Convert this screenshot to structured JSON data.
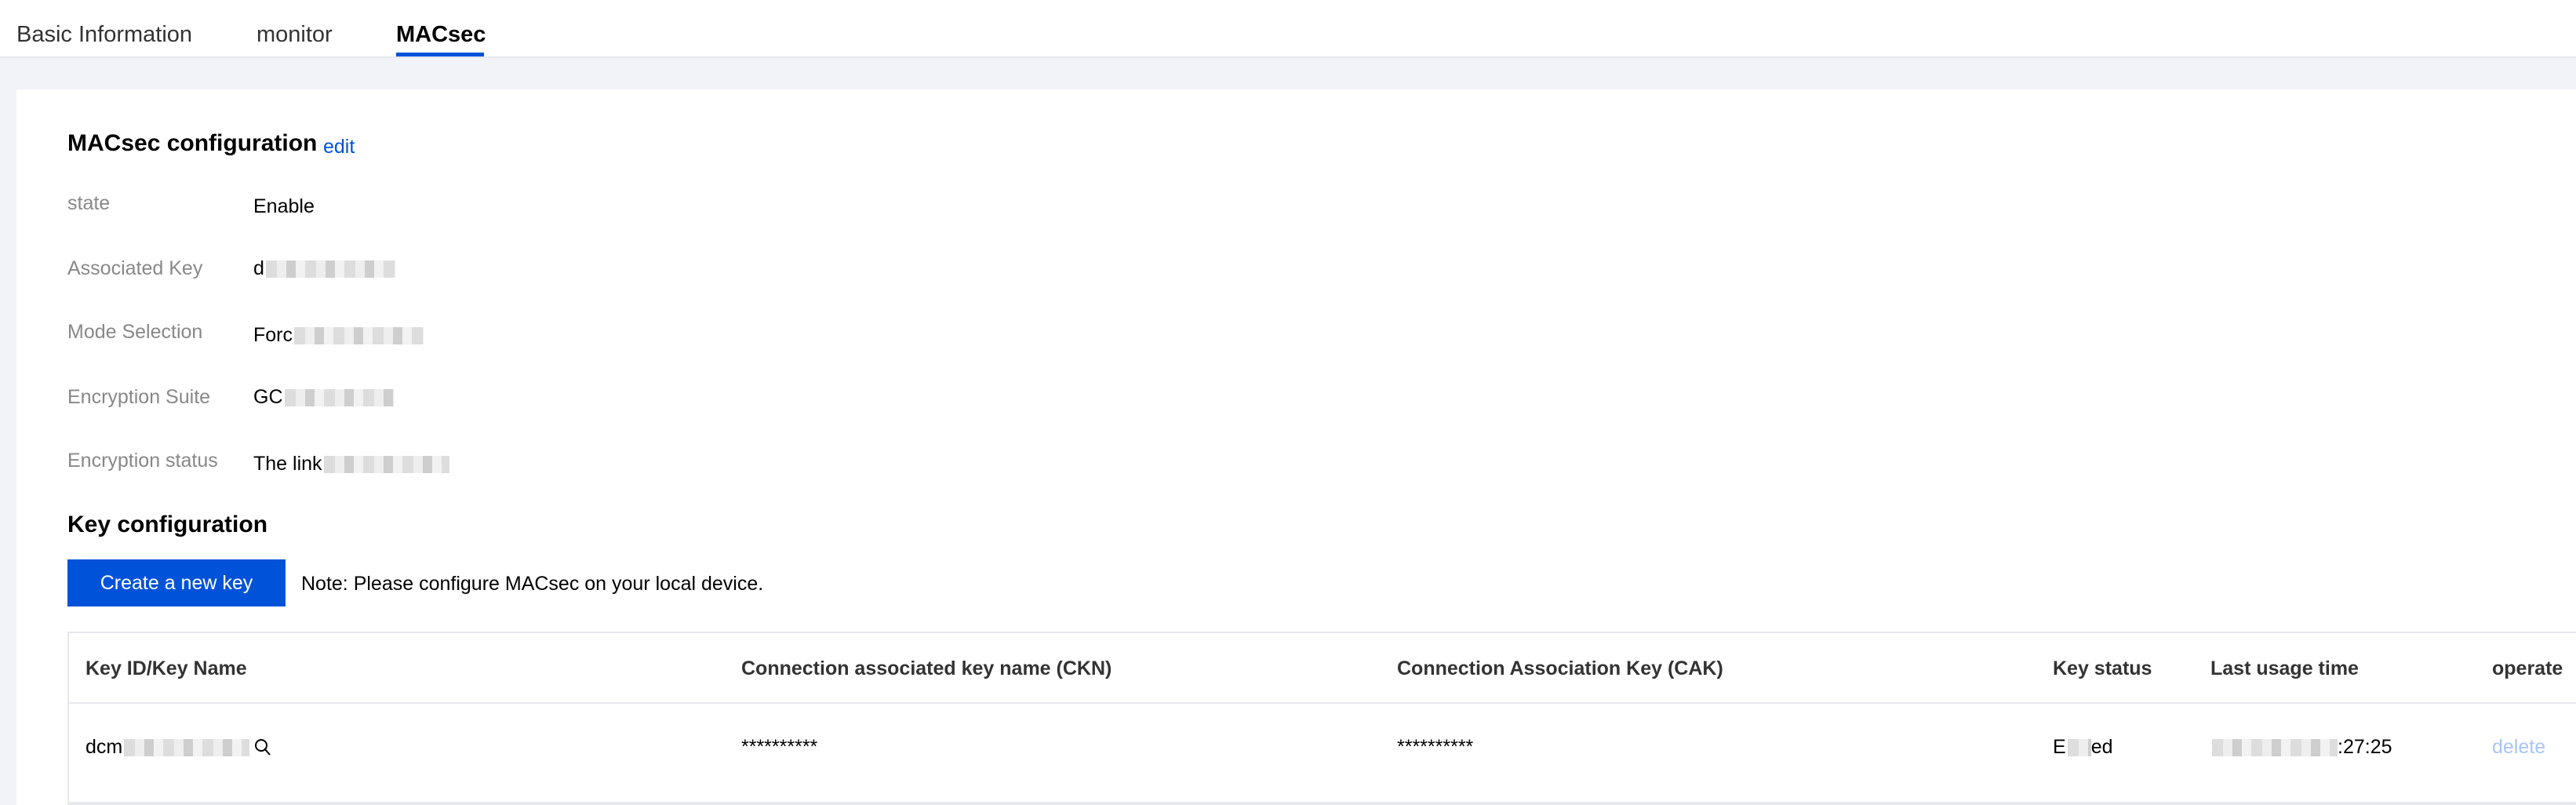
{
  "tabs": [
    {
      "label": "Basic Information"
    },
    {
      "label": "monitor"
    },
    {
      "label": "MACsec"
    }
  ],
  "macsec_config": {
    "title": "MACsec configuration",
    "edit_label": "edit",
    "rows": [
      {
        "label": "state",
        "value": "Enable"
      },
      {
        "label": "Associated Key",
        "value": "d"
      },
      {
        "label": "Mode Selection",
        "value": "Forc"
      },
      {
        "label": "Encryption Suite",
        "value": "GC"
      },
      {
        "label": "Encryption status",
        "value": "The link"
      }
    ]
  },
  "key_config": {
    "title": "Key configuration",
    "create_button": "Create a new key",
    "note": "Note: Please configure MACsec on your local device.",
    "columns": [
      "Key ID/Key Name",
      "Connection associated key name (CKN)",
      "Connection Association Key (CAK)",
      "Key status",
      "Last usage time",
      "operate"
    ],
    "rows": [
      {
        "key_id": "dcm",
        "ckn": "**********",
        "cak": "**********",
        "status_prefix": "E",
        "status_suffix": "ed",
        "last_usage_suffix": ":27:25",
        "operate": "delete"
      }
    ]
  },
  "colors": {
    "accent": "#0052d9",
    "disabled_link": "#a9c4f5"
  }
}
